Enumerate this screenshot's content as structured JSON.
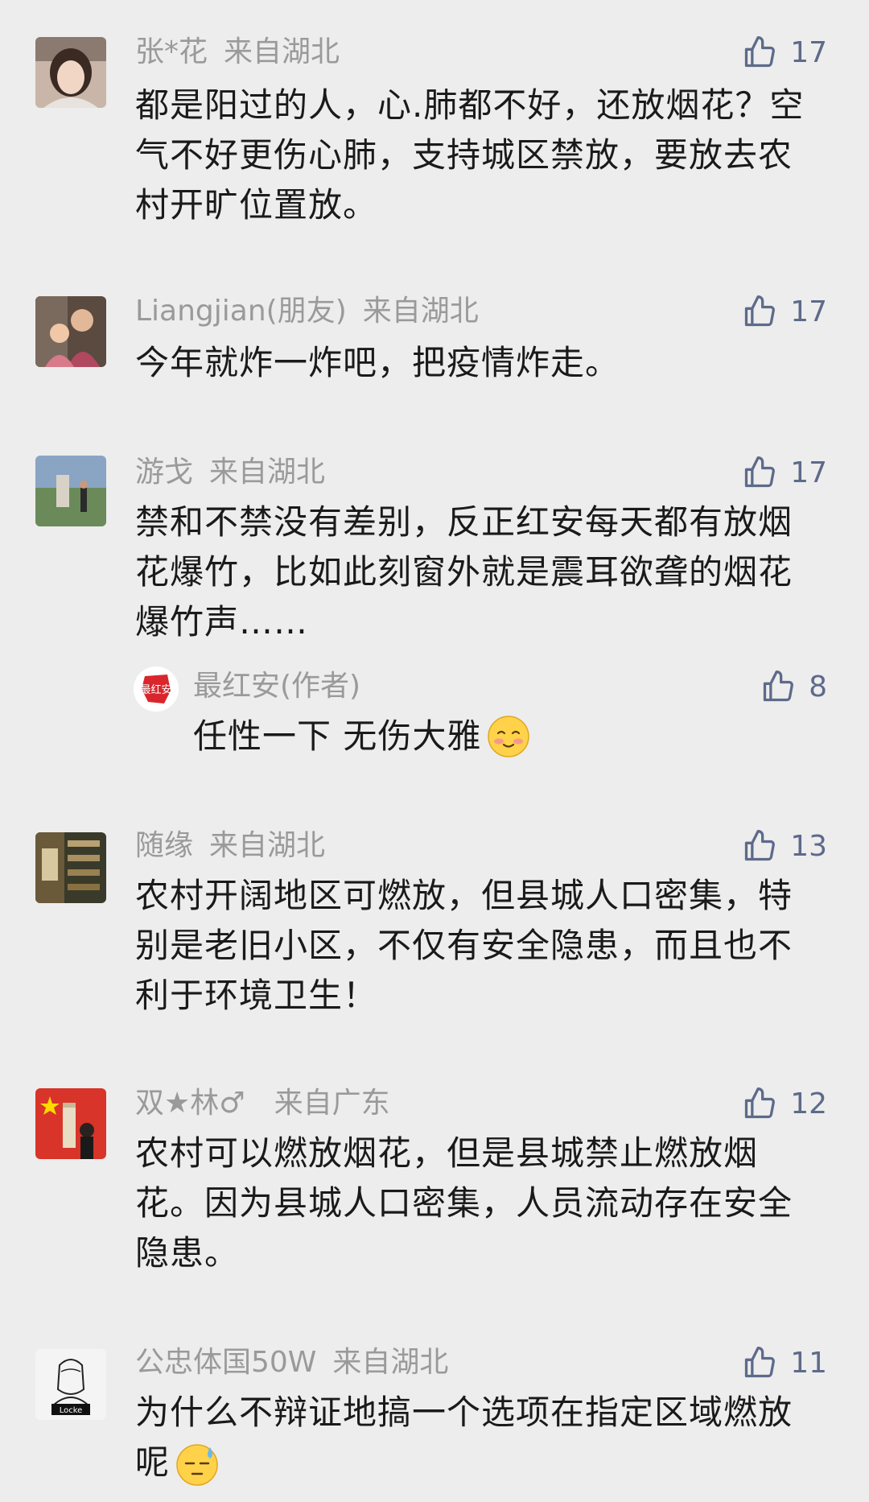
{
  "comments": [
    {
      "name": "张*花",
      "location": "来自湖北",
      "likes": "17",
      "text": "都是阳过的人，心.肺都不好，还放烟花？空气不好更伤心肺，支持城区禁放，要放去农村开旷位置放。"
    },
    {
      "name": "Liangjian(朋友)",
      "location": "来自湖北",
      "likes": "17",
      "text": "今年就炸一炸吧，把疫情炸走。"
    },
    {
      "name": "游戈",
      "location": "来自湖北",
      "likes": "17",
      "text": "禁和不禁没有差别，反正红安每天都有放烟花爆竹，比如此刻窗外就是震耳欲聋的烟花爆竹声……",
      "reply": {
        "name": "最红安(作者)",
        "likes": "8",
        "text": "任性一下 无伤大雅",
        "avatar_text": "最红安"
      }
    },
    {
      "name": "随缘",
      "location": "来自湖北",
      "likes": "13",
      "text": "农村开阔地区可燃放，但县城人口密集，特别是老旧小区，不仅有安全隐患，而且也不利于环境卫生！"
    },
    {
      "name": "双★林♂",
      "location": "来自广东",
      "likes": "12",
      "text": "农村可以燃放烟花，但是县城禁止燃放烟花。因为县城人口密集，人员流动存在安全隐患。"
    },
    {
      "name": "公忠体国50W",
      "location": "来自湖北",
      "likes": "11",
      "text": "为什么不辩证地搞一个选项在指定区域燃放呢",
      "avatar_text": "Locke"
    }
  ],
  "colors": {
    "background": "#ededed",
    "meta_text": "#9a9a9a",
    "like_icon": "#5d6a8a",
    "body_text": "#1a1a1a"
  },
  "icons": {
    "like": "thumbs-up-icon",
    "emoji_smile": "blush-emoji-icon",
    "emoji_sweat": "sweat-emoji-icon"
  }
}
